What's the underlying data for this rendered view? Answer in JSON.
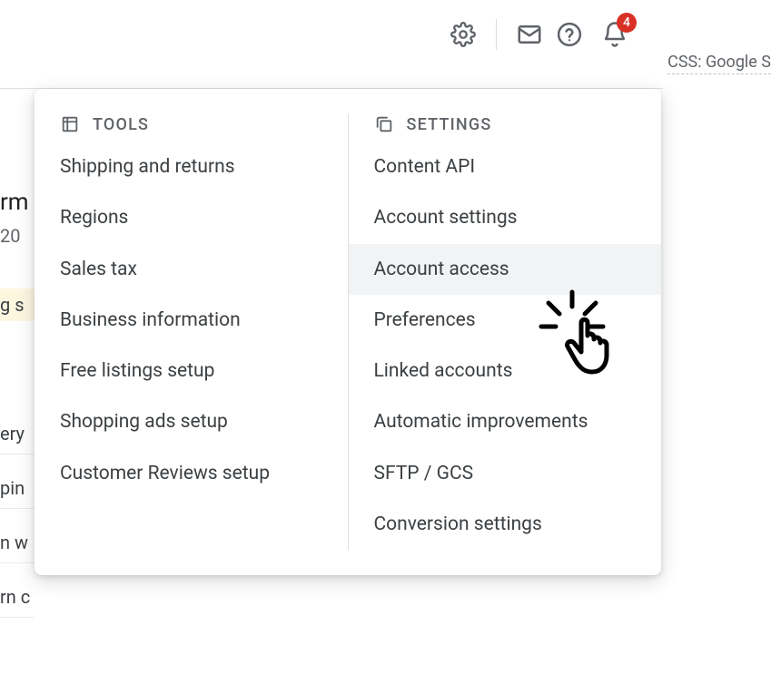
{
  "toolbar": {
    "notifications_count": "4"
  },
  "css_link_text": "CSS: Google S",
  "dropdown": {
    "tools": {
      "header": "TOOLS",
      "items": [
        "Shipping and returns",
        "Regions",
        "Sales tax",
        "Business information",
        "Free listings setup",
        "Shopping ads setup",
        "Customer Reviews setup"
      ]
    },
    "settings": {
      "header": "SETTINGS",
      "items": [
        "Content API",
        "Account settings",
        "Account access",
        "Preferences",
        "Linked accounts",
        "Automatic improvements",
        "SFTP / GCS",
        "Conversion settings"
      ],
      "highlighted_index": 2
    }
  },
  "background": {
    "heading_frag": "rm",
    "sub_frag": "20",
    "yellow_frag": "g s",
    "row1": "ery",
    "row2": "pin",
    "row3": "n w",
    "row4": "rn c"
  }
}
